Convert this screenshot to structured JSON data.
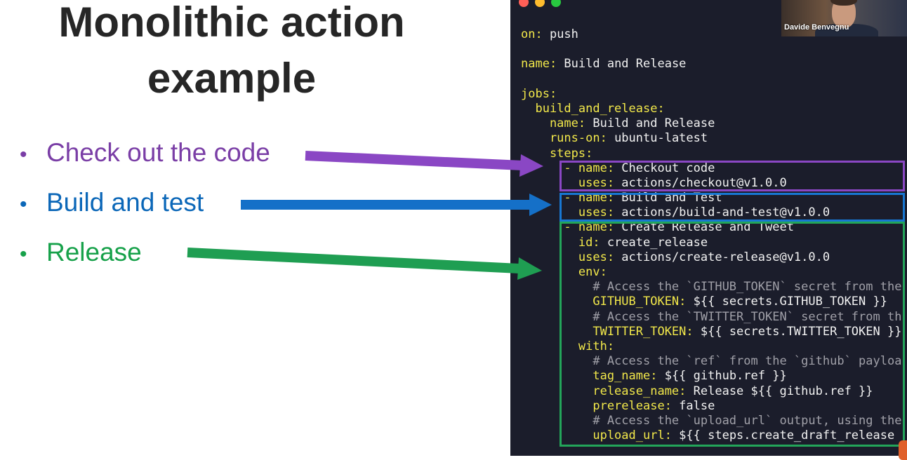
{
  "slide": {
    "title_line1": "Monolithic action",
    "title_line2": "example",
    "bullet_glyph": "•",
    "bullets": [
      {
        "text": "Check out the code",
        "color": "#7a3ea6"
      },
      {
        "text": "Build and test",
        "color": "#0b67b8"
      },
      {
        "text": "Release",
        "color": "#17a14a"
      }
    ]
  },
  "editor": {
    "window_controls": [
      "red",
      "yellow",
      "green"
    ],
    "highlight_colors": [
      "#8a47c4",
      "#1877d2",
      "#23a55a"
    ],
    "lines": [
      {
        "key": "on:",
        "value": " push"
      },
      {
        "key": "",
        "value": ""
      },
      {
        "key": "name:",
        "value": " Build and Release"
      },
      {
        "key": "",
        "value": ""
      },
      {
        "key": "jobs:",
        "value": ""
      },
      {
        "key": "  build_and_release:",
        "value": ""
      },
      {
        "key": "    name:",
        "value": " Build and Release"
      },
      {
        "key": "    runs-on:",
        "value": " ubuntu-latest"
      },
      {
        "key": "    steps:",
        "value": ""
      },
      {
        "key": "      - name:",
        "value": " Checkout code"
      },
      {
        "key": "        uses:",
        "value": " actions/checkout@v1.0.0"
      },
      {
        "key": "      - name:",
        "value": " Build and Test"
      },
      {
        "key": "        uses:",
        "value": " actions/build-and-test@v1.0.0"
      },
      {
        "key": "      - name:",
        "value": " Create Release and Tweet"
      },
      {
        "key": "        id:",
        "value": " create_release"
      },
      {
        "key": "        uses:",
        "value": " actions/create-release@v1.0.0"
      },
      {
        "key": "        env:",
        "value": ""
      },
      {
        "comment": "          # Access the `GITHUB_TOKEN` secret from the"
      },
      {
        "key": "          GITHUB_TOKEN:",
        "value": " ${{ secrets.GITHUB_TOKEN }}"
      },
      {
        "comment": "          # Access the `TWITTER_TOKEN` secret from th"
      },
      {
        "key": "          TWITTER_TOKEN:",
        "value": " ${{ secrets.TWITTER_TOKEN }}"
      },
      {
        "key": "        with:",
        "value": ""
      },
      {
        "comment": "          # Access the `ref` from the `github` payloa"
      },
      {
        "key": "          tag_name:",
        "value": " ${{ github.ref }}"
      },
      {
        "key": "          release_name:",
        "value": " Release ${{ github.ref }}"
      },
      {
        "key": "          prerelease:",
        "value": " false"
      },
      {
        "comment": "          # Access the `upload_url` output, using the"
      },
      {
        "key": "          upload_url:",
        "value": " ${{ steps.create_draft_release"
      }
    ]
  },
  "webcam": {
    "presenter_name": "Davide Benvegnu"
  }
}
